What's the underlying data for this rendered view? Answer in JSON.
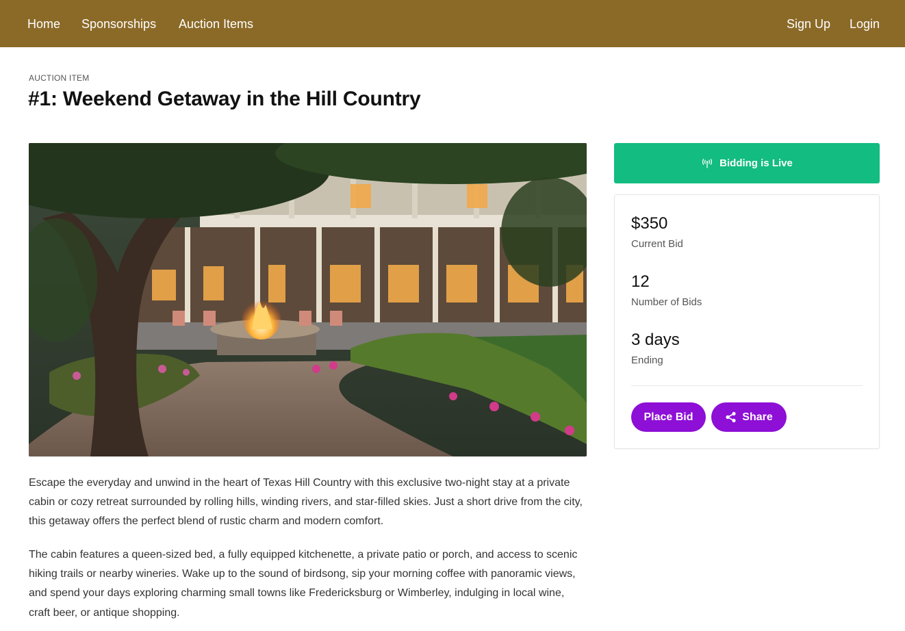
{
  "nav": {
    "home": "Home",
    "sponsorships": "Sponsorships",
    "auction_items": "Auction Items",
    "sign_up": "Sign Up",
    "login": "Login"
  },
  "header": {
    "eyebrow": "AUCTION ITEM",
    "title": "#1: Weekend Getaway in the Hill Country"
  },
  "description": [
    "Escape the everyday and unwind in the heart of Texas Hill Country with this exclusive two-night stay at a private cabin or cozy retreat surrounded by rolling hills, winding rivers, and star-filled skies. Just a short drive from the city, this getaway offers the perfect blend of rustic charm and modern comfort.",
    "The cabin features a queen-sized bed, a fully equipped kitchenette, a private patio or porch, and access to scenic hiking trails or nearby wineries. Wake up to the sound of birdsong, sip your morning coffee with panoramic views, and spend your days exploring charming small towns like Fredericksburg or Wimberley, indulging in local wine, craft beer, or antique shopping."
  ],
  "status": {
    "label": "Bidding is Live",
    "icon": "broadcast-icon",
    "color": "#13bc80"
  },
  "stats": {
    "current_bid_value": "$350",
    "current_bid_label": "Current Bid",
    "bids_value": "12",
    "bids_label": "Number of Bids",
    "ending_value": "3 days",
    "ending_label": "Ending"
  },
  "actions": {
    "place_bid": "Place Bid",
    "share": "Share",
    "share_icon": "share-icon",
    "button_color": "#8e0fd6"
  },
  "theme": {
    "nav_color": "#8b6a28"
  }
}
